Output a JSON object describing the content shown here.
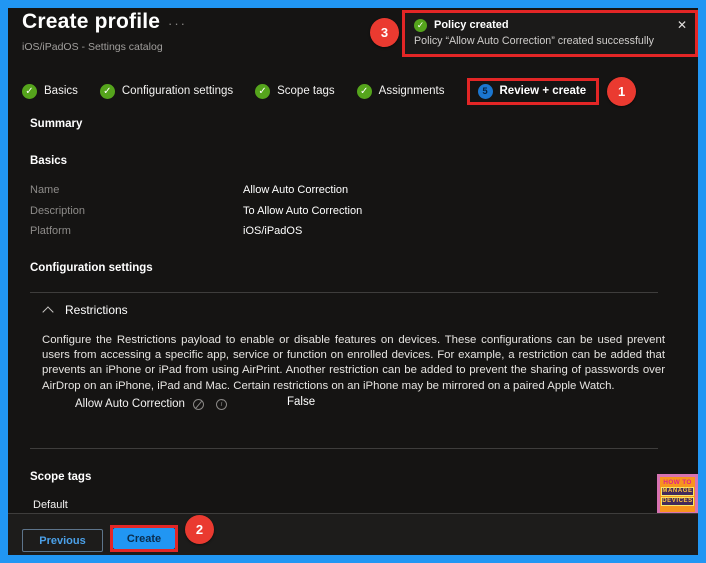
{
  "page": {
    "title": "Create profile",
    "subtitle": "iOS/iPadOS - Settings catalog"
  },
  "icons": {
    "check": "✓",
    "close": "✕",
    "ellipsis": "···",
    "info": "i"
  },
  "notification": {
    "title": "Policy created",
    "message": "Policy “Allow Auto Correction” created successfully"
  },
  "steps": [
    {
      "label": "Basics",
      "state": "complete"
    },
    {
      "label": "Configuration settings",
      "state": "complete"
    },
    {
      "label": "Scope tags",
      "state": "complete"
    },
    {
      "label": "Assignments",
      "state": "complete"
    },
    {
      "label": "Review + create",
      "state": "current",
      "number": "5"
    }
  ],
  "summary": {
    "heading": "Summary",
    "basics": {
      "heading": "Basics",
      "rows": [
        {
          "label": "Name",
          "value": "Allow Auto Correction"
        },
        {
          "label": "Description",
          "value": "To Allow Auto Correction"
        },
        {
          "label": "Platform",
          "value": "iOS/iPadOS"
        }
      ]
    },
    "configuration": {
      "heading": "Configuration settings",
      "section": "Restrictions",
      "description": "Configure the Restrictions payload to enable or disable features on devices. These configurations can be used prevent users from accessing a specific app, service or function on enrolled devices. For example, a restriction can be added that prevents an iPhone or iPad from using AirPrint. Another restriction can be added to prevent the sharing of passwords over AirDrop on an iPhone, iPad and Mac. Certain restrictions on an iPhone may be mirrored on a paired Apple Watch.",
      "setting": {
        "label": "Allow Auto Correction",
        "value": "False"
      }
    },
    "scope_tags": {
      "heading": "Scope tags",
      "value": "Default"
    }
  },
  "footer": {
    "previous_label": "Previous",
    "create_label": "Create"
  },
  "annotations": {
    "badge1": "1",
    "badge2": "2",
    "badge3": "3"
  },
  "logo": {
    "line1": "HOW TO",
    "line2": "MANAGE",
    "line3": "DEVICES"
  },
  "colors": {
    "frame_blue": "#2196f3",
    "annotation_red": "#e32626",
    "badge_red": "#ea3a30",
    "success_green": "#55a41c",
    "current_step_blue": "#1b76cf",
    "create_button_blue": "#2196f3",
    "background": "#151413"
  }
}
